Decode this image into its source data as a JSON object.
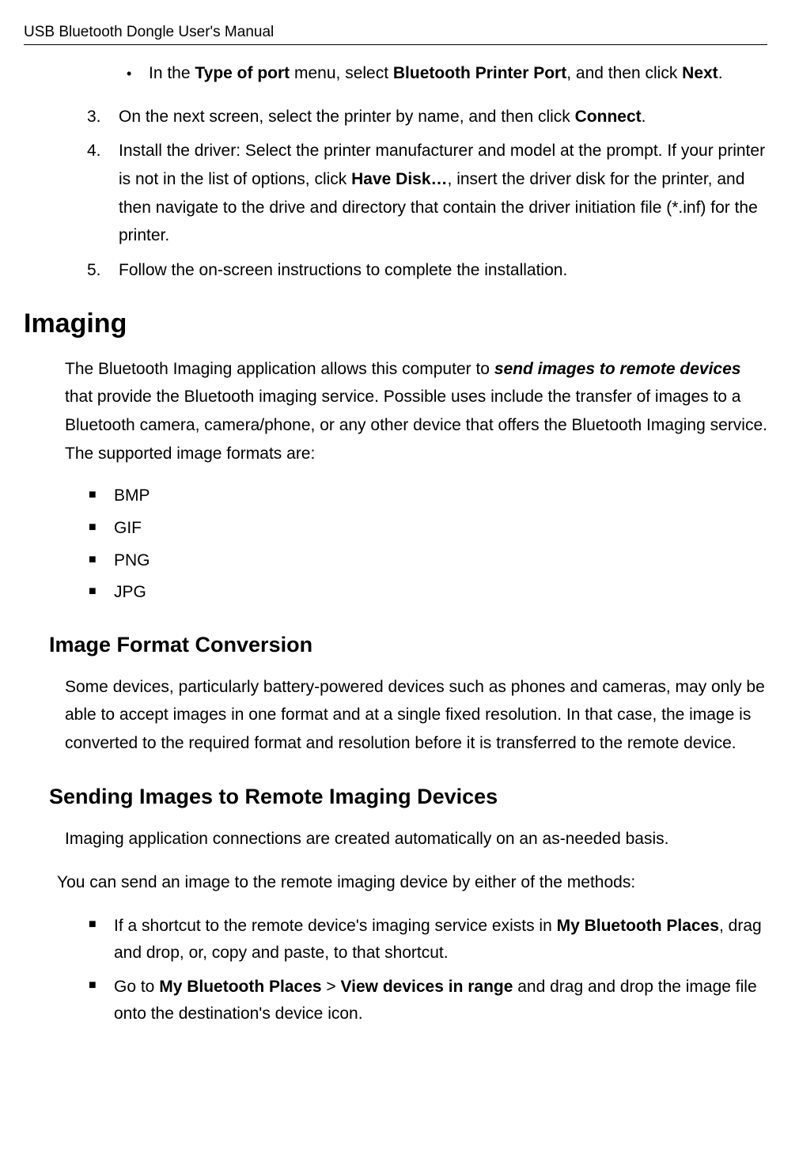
{
  "header": "USB Bluetooth Dongle User's Manual",
  "top_bullet_prefix": "In the ",
  "top_bullet_b1": "Type of port",
  "top_bullet_mid": " menu, select ",
  "top_bullet_b2": "Bluetooth Printer Port",
  "top_bullet_mid2": ", and then click ",
  "top_bullet_b3": "Next",
  "top_bullet_end": ".",
  "step3_num": "3.",
  "step3_a": "On the next screen, select the printer by name, and then click ",
  "step3_b": "Connect",
  "step3_c": ".",
  "step4_num": "4.",
  "step4_a": "Install the driver: Select the printer manufacturer and model at the prompt. If your printer is not in the list of options, click ",
  "step4_b": "Have Disk…",
  "step4_c": ", insert the driver disk for the printer, and then navigate to the drive and directory that contain the driver initiation file (*.inf) for the printer.",
  "step5_num": "5.",
  "step5_a": "Follow the on-screen instructions to complete the installation.",
  "sec_imaging": "Imaging",
  "imaging_p_a": "The Bluetooth Imaging application allows this computer to ",
  "imaging_p_b": "send images to remote devices",
  "imaging_p_c": " that provide the Bluetooth imaging service. Possible uses include the transfer of images to a Bluetooth camera, camera/phone, or any other device that offers the Bluetooth Imaging service. The supported image formats are:",
  "fmt1": "BMP",
  "fmt2": "GIF",
  "fmt3": "PNG",
  "fmt4": "JPG",
  "sub_conv": "Image Format Conversion",
  "conv_p": "Some devices, particularly battery-powered devices such as phones and cameras, may only be able to accept images in one format and at a single fixed resolution. In that case, the image is converted to the required format and resolution before it is transferred to the remote device.",
  "sub_send": "Sending Images to Remote Imaging Devices",
  "send_p1": "Imaging application connections are created automatically on an as-needed basis.",
  "send_p2": "You can send an image to the remote imaging device by either of the methods:",
  "send_i1_a": "If a shortcut to the remote device's imaging service exists in ",
  "send_i1_b": "My Bluetooth Places",
  "send_i1_c": ", drag and drop, or, copy and paste, to that shortcut.",
  "send_i2_a": "Go to ",
  "send_i2_b": "My Bluetooth Places",
  "send_i2_c": " > ",
  "send_i2_d": "View devices in range",
  "send_i2_e": " and drag and drop the image file onto the destination's device icon."
}
